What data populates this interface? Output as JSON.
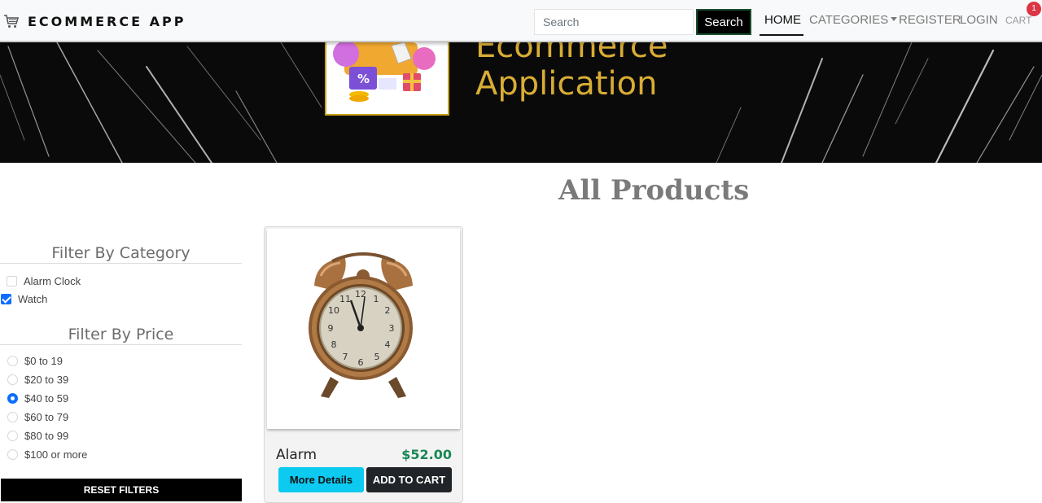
{
  "navbar": {
    "brand": "ECOMMERCE APP",
    "search_placeholder": "Search",
    "search_value": "",
    "search_button": "Search",
    "links": {
      "home": "HOME",
      "categories": "CATEGORIES",
      "register": "REGISTER",
      "login": "LOGIN",
      "cart": "CART"
    },
    "cart_count": "1",
    "cart_badge_color": "#dc3545"
  },
  "banner": {
    "title_line_1": "Ecommerce",
    "title_line_2": "Application",
    "accent_color": "#d9ad34"
  },
  "main": {
    "title": "All Products"
  },
  "filters": {
    "category_heading": "Filter By Category",
    "categories": [
      {
        "label": "Alarm Clock",
        "checked": false
      },
      {
        "label": "Watch",
        "checked": true
      }
    ],
    "price_heading": "Filter By Price",
    "prices": [
      {
        "label": "$0 to 19",
        "selected": false
      },
      {
        "label": "$20 to 39",
        "selected": false
      },
      {
        "label": "$40 to 59",
        "selected": true
      },
      {
        "label": "$60 to 79",
        "selected": false
      },
      {
        "label": "$80 to 99",
        "selected": false
      },
      {
        "label": "$100 or more",
        "selected": false
      }
    ],
    "reset_label": "RESET FILTERS"
  },
  "products": [
    {
      "name": "Alarm",
      "price": "$52.00",
      "image_icon": "alarm-clock-image",
      "details_label": "More Details",
      "cart_label": "ADD TO CART"
    }
  ],
  "colors": {
    "primary_blue": "#0d6efd",
    "info_cyan": "#0dcaf0",
    "price_green": "#198754",
    "dark": "#212529"
  }
}
